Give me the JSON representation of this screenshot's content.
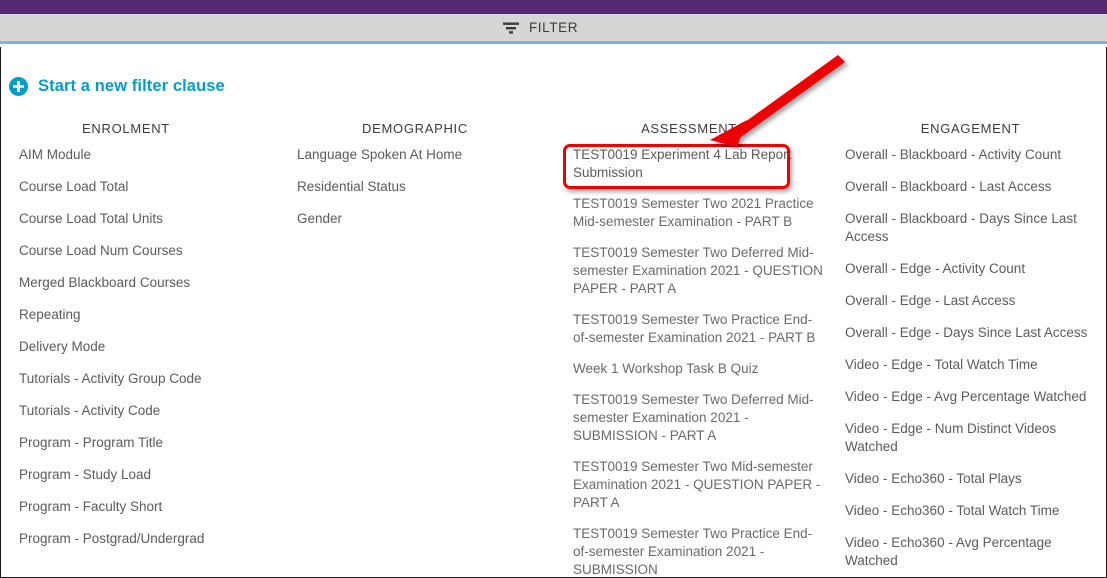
{
  "window": {
    "title_bar_color": "#542a73",
    "accent_color": "#00a0c6",
    "divider_color": "#7fb4d4",
    "annotation_color": "#ee0000"
  },
  "toolbar": {
    "filter_label": "FILTER",
    "filter_icon": "filter-icon"
  },
  "new_clause": {
    "label": "Start a new filter clause",
    "icon": "plus-circle-icon"
  },
  "columns": [
    {
      "key": "enrolment",
      "header": "ENROLMENT",
      "items": [
        "AIM Module",
        "Course Load Total",
        "Course Load Total Units",
        "Course Load Num Courses",
        "Merged Blackboard Courses",
        "Repeating",
        "Delivery Mode",
        "Tutorials - Activity Group Code",
        "Tutorials - Activity Code",
        "Program - Program Title",
        "Program - Study Load",
        "Program - Faculty Short",
        "Program - Postgrad/Undergrad"
      ]
    },
    {
      "key": "demographic",
      "header": "DEMOGRAPHIC",
      "items": [
        "Language Spoken At Home",
        "Residential Status",
        "Gender"
      ]
    },
    {
      "key": "assessment",
      "header": "ASSESSMENT",
      "items": [
        "TEST0019 Experiment 4 Lab Report Submission",
        "TEST0019 Semester Two 2021 Practice Mid-semester Examination - PART B",
        "TEST0019 Semester Two Deferred Mid-semester Examination 2021 - QUESTION PAPER - PART A",
        "TEST0019 Semester Two Practice End-of-semester Examination 2021 - PART B",
        "Week 1 Workshop Task B Quiz",
        "TEST0019 Semester Two Deferred Mid-semester Examination 2021 - SUBMISSION - PART A",
        "TEST0019 Semester Two Mid-semester Examination 2021 - QUESTION PAPER - PART A",
        "TEST0019 Semester Two Practice End-of-semester Examination 2021 - SUBMISSION"
      ],
      "highlighted_index": 0
    },
    {
      "key": "engagement",
      "header": "ENGAGEMENT",
      "items": [
        "Overall - Blackboard - Activity Count",
        "Overall - Blackboard - Last Access",
        "Overall - Blackboard - Days Since Last Access",
        "Overall - Edge - Activity Count",
        "Overall - Edge - Last Access",
        "Overall - Edge - Days Since Last Access",
        "Video - Edge - Total Watch Time",
        "Video - Edge - Avg Percentage Watched",
        "Video - Edge - Num Distinct Videos Watched",
        "Video - Echo360 - Total Plays",
        "Video - Echo360 - Total Watch Time",
        "Video - Echo360 - Avg Percentage Watched"
      ]
    }
  ],
  "annotations": {
    "arrow_icon": "red-arrow-icon",
    "highlight_box": "red-highlight-box"
  }
}
